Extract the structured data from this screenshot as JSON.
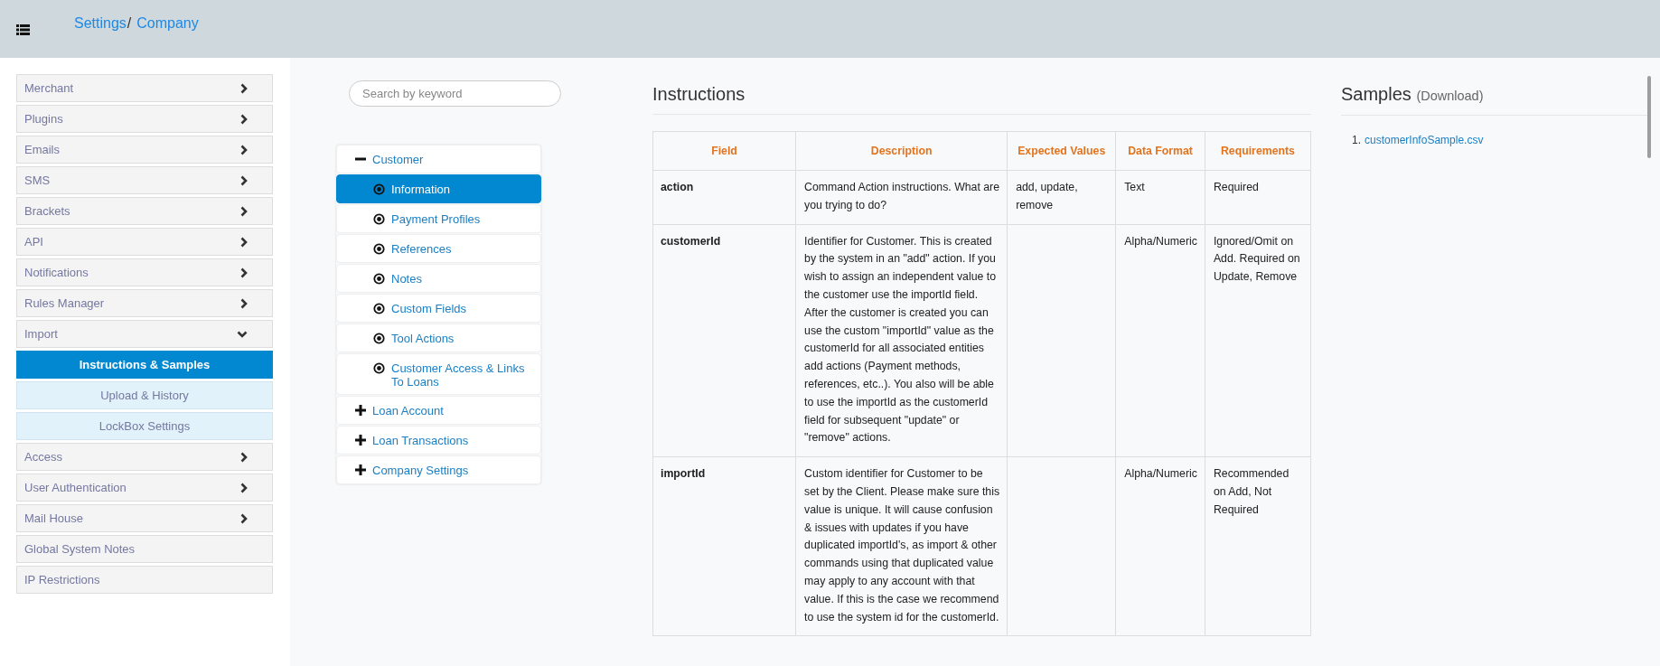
{
  "header": {
    "breadcrumb": [
      {
        "label": "Settings"
      },
      {
        "label": "Company"
      }
    ],
    "separator": "/"
  },
  "sidebar": {
    "items": [
      {
        "label": "Merchant",
        "kind": "section",
        "expanded": false
      },
      {
        "label": "Plugins",
        "kind": "section",
        "expanded": false
      },
      {
        "label": "Emails",
        "kind": "section",
        "expanded": false
      },
      {
        "label": "SMS",
        "kind": "section",
        "expanded": false
      },
      {
        "label": "Brackets",
        "kind": "section",
        "expanded": false
      },
      {
        "label": "API",
        "kind": "section",
        "expanded": false
      },
      {
        "label": "Notifications",
        "kind": "section",
        "expanded": false
      },
      {
        "label": "Rules Manager",
        "kind": "section",
        "expanded": false
      },
      {
        "label": "Import",
        "kind": "section",
        "expanded": true,
        "children": [
          {
            "label": "Instructions & Samples",
            "selected": true
          },
          {
            "label": "Upload & History",
            "selected": false
          },
          {
            "label": "LockBox Settings",
            "selected": false
          }
        ]
      },
      {
        "label": "Access",
        "kind": "section",
        "expanded": false
      },
      {
        "label": "User Authentication",
        "kind": "section",
        "expanded": false
      },
      {
        "label": "Mail House",
        "kind": "section",
        "expanded": false
      },
      {
        "label": "Global System Notes",
        "kind": "link"
      },
      {
        "label": "IP Restrictions",
        "kind": "link"
      }
    ]
  },
  "search": {
    "placeholder": "Search by keyword"
  },
  "tree": [
    {
      "label": "Customer",
      "expanded": true,
      "children": [
        {
          "label": "Information",
          "selected": true
        },
        {
          "label": "Payment Profiles",
          "selected": false
        },
        {
          "label": "References",
          "selected": false
        },
        {
          "label": "Notes",
          "selected": false
        },
        {
          "label": "Custom Fields",
          "selected": false
        },
        {
          "label": "Tool Actions",
          "selected": false
        },
        {
          "label": "Customer Access & Links To Loans",
          "selected": false
        }
      ]
    },
    {
      "label": "Loan Account",
      "expanded": false
    },
    {
      "label": "Loan Transactions",
      "expanded": false
    },
    {
      "label": "Company Settings",
      "expanded": false
    }
  ],
  "instructions": {
    "title": "Instructions",
    "table": {
      "columns": [
        "Field",
        "Description",
        "Expected Values",
        "Data Format",
        "Requirements"
      ],
      "rows": [
        [
          "action",
          "Command Action instructions. What are you trying to do?",
          "add, update, remove",
          "Text",
          "Required"
        ],
        [
          "customerId",
          "Identifier for Customer. This is created by the system in an \"add\" action. If you wish to assign an independent value to the customer use the importId field. After the customer is created you can use the custom \"importId\" value as the customerId for all associated entities add actions (Payment methods, references, etc..). You also will be able to use the importId as the customerId field for subsequent \"update\" or \"remove\" actions.",
          "",
          "Alpha/Numeric",
          "Ignored/Omit on Add. Required on Update, Remove"
        ],
        [
          "importId",
          "Custom identifier for Customer to be set by the Client. Please make sure this value is unique. It will cause confusion & issues with updates if you have duplicated importId's, as import & other commands using that duplicated value may apply to any account with that value. If this is the case we recommend to use the system id for the customerId.",
          "",
          "Alpha/Numeric",
          "Recommended on Add, Not Required"
        ]
      ]
    }
  },
  "samples": {
    "title": "Samples",
    "subtitle": "(Download)",
    "files": [
      {
        "number": "1.",
        "name": "customerInfoSample.csv"
      }
    ]
  }
}
